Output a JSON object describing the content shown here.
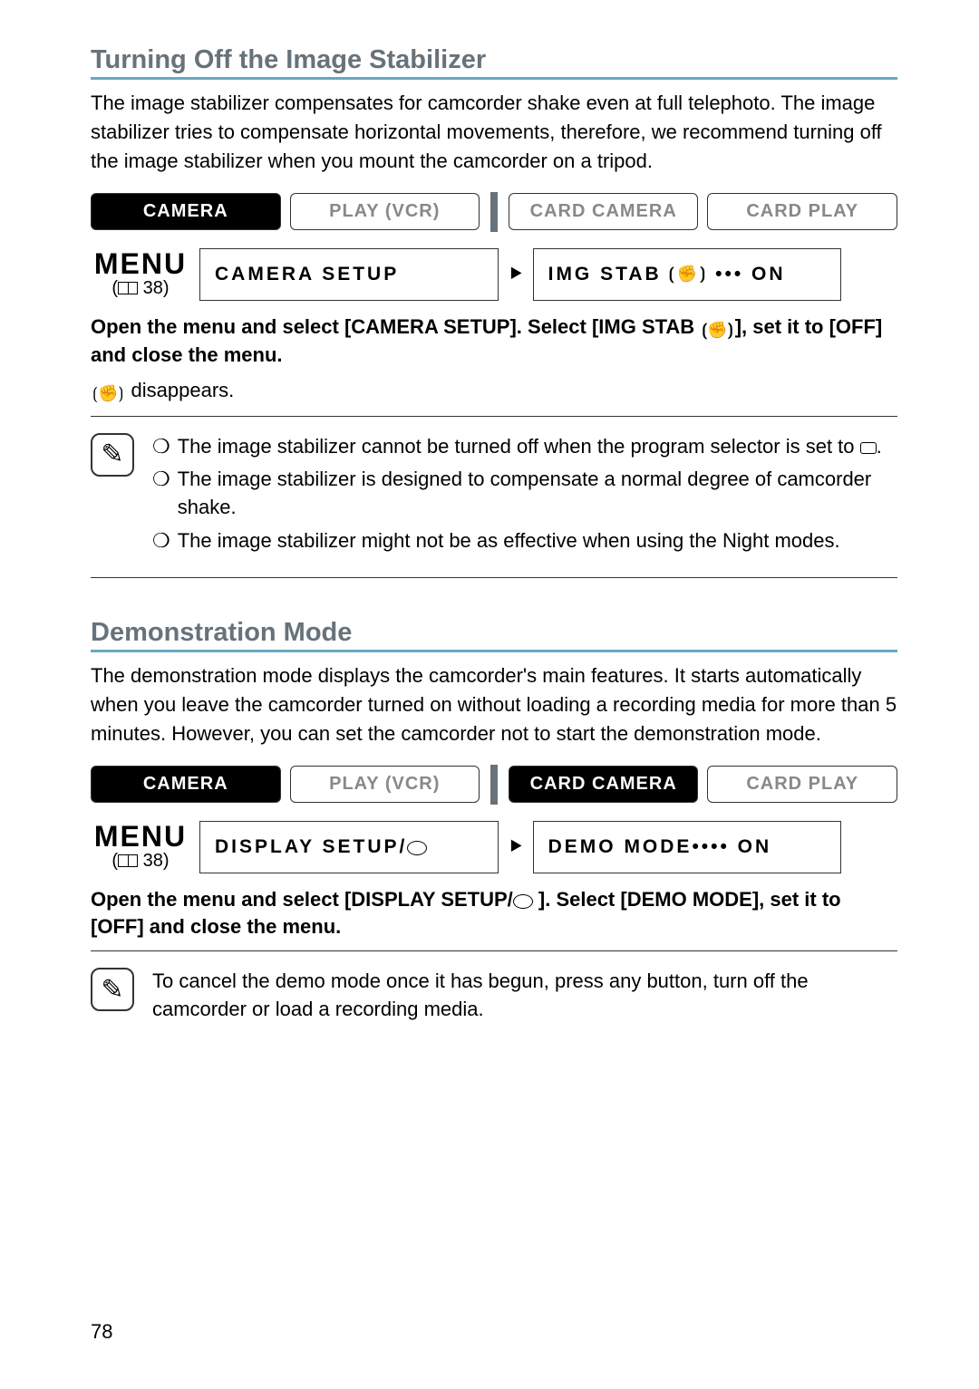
{
  "sections": {
    "s1": {
      "heading": "Turning Off the Image Stabilizer",
      "body": "The image stabilizer compensates for camcorder shake even at full telephoto. The image stabilizer tries to compensate horizontal movements, therefore, we recommend turning off the image stabilizer when you mount the camcorder on a tripod.",
      "modes": {
        "m1": "CAMERA",
        "m2": "PLAY (VCR)",
        "m3": "CARD CAMERA",
        "m4": "CARD PLAY"
      },
      "menu": {
        "word": "MENU",
        "ref": "38",
        "box1": "CAMERA SETUP",
        "box2": "IMG STAB",
        "box2_val": "••• ON"
      },
      "instruction_a": "Open the menu and select [CAMERA SETUP]. Select [IMG STAB ",
      "instruction_b": "], set it to [OFF] and close the menu.",
      "status": " disappears.",
      "notes": {
        "n1a": "The image stabilizer cannot be turned off when the program selector is set to ",
        "n1b": ".",
        "n2": "The image stabilizer is designed to compensate a normal degree of camcorder shake.",
        "n3": "The image stabilizer might not be as effective when using the Night modes."
      }
    },
    "s2": {
      "heading": "Demonstration Mode",
      "body": "The demonstration mode displays the camcorder's main features. It starts automatically when you leave the camcorder turned on without loading a recording media for more than 5 minutes. However, you can set the camcorder not to start the demonstration mode.",
      "modes": {
        "m1": "CAMERA",
        "m2": "PLAY (VCR)",
        "m3": "CARD CAMERA",
        "m4": "CARD PLAY"
      },
      "menu": {
        "word": "MENU",
        "ref": "38",
        "box1": "DISPLAY SETUP/",
        "box2": "DEMO MODE•••• ON"
      },
      "instruction_a": "Open the menu and select [DISPLAY SETUP/",
      "instruction_b": " ]. Select [DEMO MODE], set it to [OFF] and close the menu.",
      "notes": {
        "n1": "To cancel the demo mode once it has begun, press any button, turn off the camcorder or load a recording media."
      }
    }
  },
  "page_number": "78"
}
